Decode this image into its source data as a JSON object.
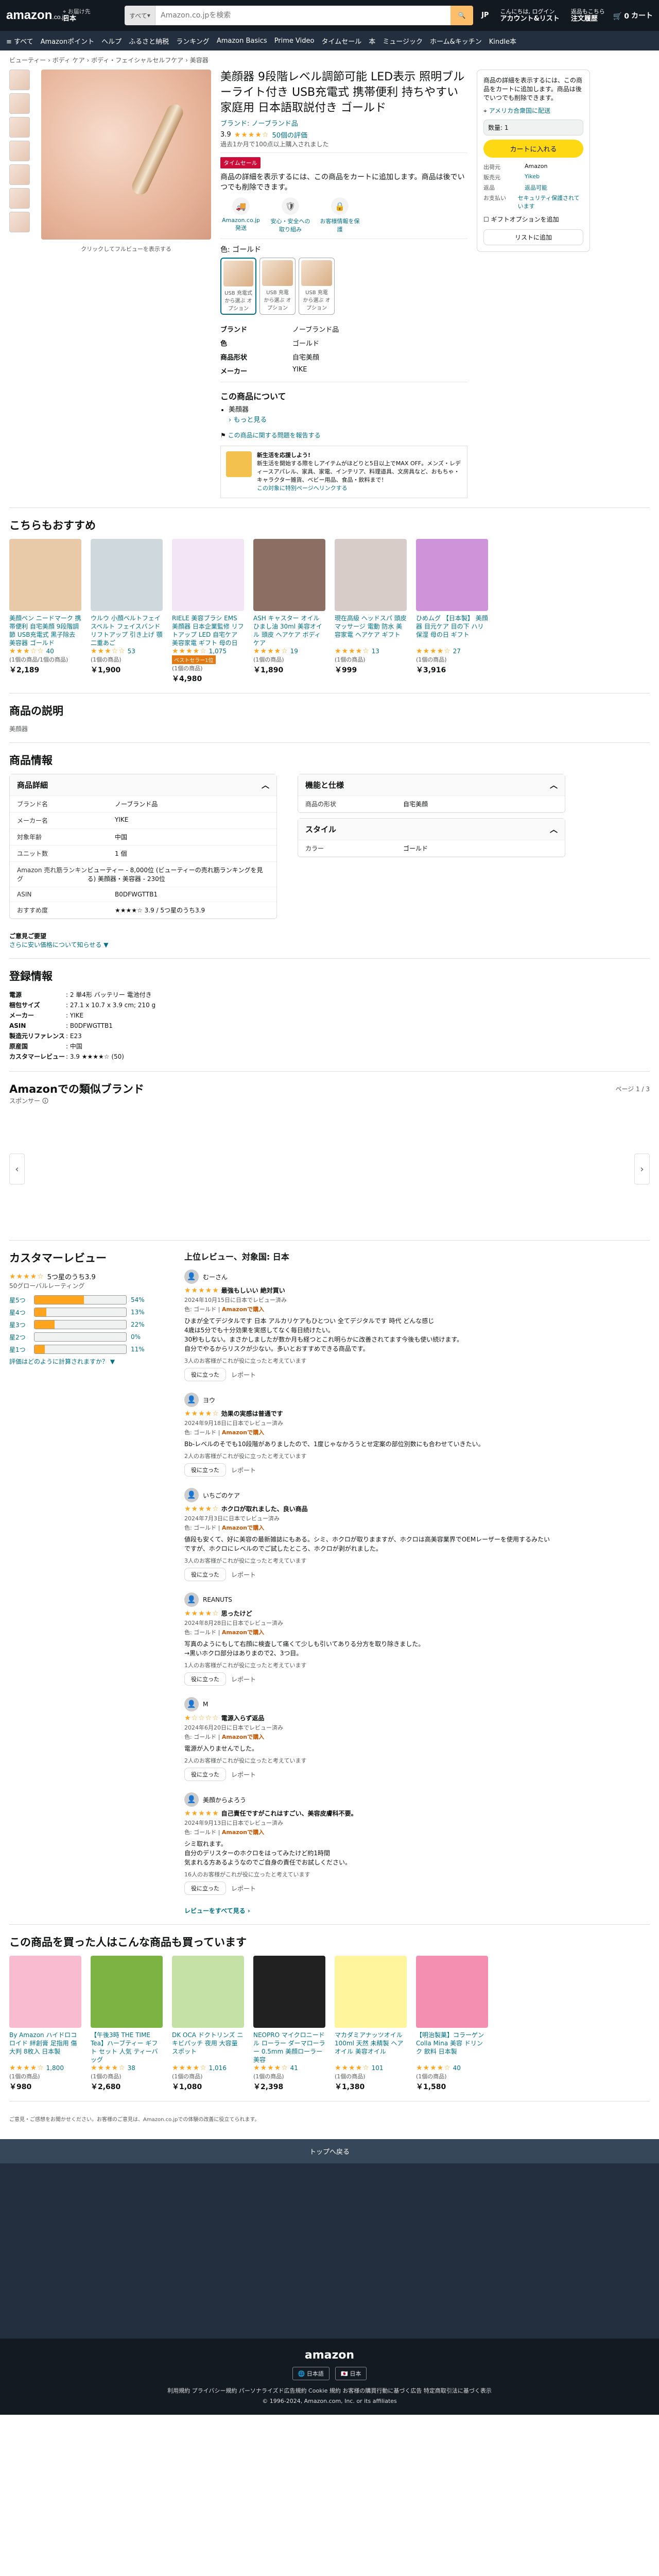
{
  "header": {
    "logo": "amazon",
    "logo_suffix": ".co.jp",
    "deliver_line1": "お届け先",
    "deliver_line2": "日本",
    "search_category": "すべて",
    "search_placeholder": "Amazon.co.jpを検索",
    "lang": "JP",
    "account_line1": "こんにちは, ログイン",
    "account_line2": "アカウント&リスト",
    "orders_line1": "返品もこちら",
    "orders_line2": "注文履歴",
    "cart_label": "カート",
    "cart_count": "0"
  },
  "nav": {
    "menu": "≡ すべて",
    "items": [
      "Amazonポイント",
      "ヘルプ",
      "ふるさと納税",
      "ランキング",
      "Amazon Basics",
      "Prime Video",
      "タイムセール",
      "本",
      "ミュージック",
      "ホーム&キッチン",
      "Kindle本"
    ]
  },
  "breadcrumb": "ビューティー › ボディ ケア › ボディ・フェイシャルセルフケア › 美容器",
  "product": {
    "title": "美顔器 9段階レベル調節可能 LED表示 照明ブルーライト付き USB充電式 携帯便利 持ちやすい 家庭用 日本語取説付き ゴールド",
    "brand": "ブランド: ノーブランド品",
    "rating": "3.9",
    "stars": "★★★★☆",
    "rating_count": "50個の評価",
    "past_month": "過去1か月で100点以上購入されました",
    "badge": "タイムセール",
    "notice": "商品の詳細を表示するには、この商品をカートに追加します。商品は後でいつでも削除できます。",
    "image_note": "クリックしてフルビューを表示する",
    "features": [
      {
        "label": "Amazon.co.jp 発送",
        "icon": "truck-icon"
      },
      {
        "label": "安心・安全への取り組み",
        "icon": "shield-icon"
      },
      {
        "label": "お客様情報を保護",
        "icon": "lock-icon"
      }
    ],
    "color_label": "色: ゴールド",
    "swatches": [
      {
        "name": "USB 充電式",
        "sub": "から選ぶ オプション"
      },
      {
        "name": "USB 充電",
        "sub": "から選ぶ オプション"
      },
      {
        "name": "USB 充電",
        "sub": "から選ぶ オプション"
      }
    ],
    "specs": [
      {
        "k": "ブランド",
        "v": "ノーブランド品"
      },
      {
        "k": "色",
        "v": "ゴールド"
      },
      {
        "k": "商品形状",
        "v": "自宅美顔"
      },
      {
        "k": "メーカー",
        "v": "YIKE"
      }
    ],
    "about_title": "この商品について",
    "about_items": [
      "美顔器",
      "› もっと見る"
    ],
    "report": "この商品に関する問題を報告する",
    "promo_title": "新生活を応援しよう!",
    "promo_text": "新生活を開始する際をしアイテムがほどりと5日以上でMAX OFF。メンズ・レディースアパレル、家具、家電、インテリア、料理道具、文房具など、おもちゃ・キャラクター雑貨、ベビー用品、食品・飲料まで！",
    "promo_link": "この対象に特別ページへリンクする"
  },
  "buybox": {
    "text": "商品の詳細を表示するには、この商品をカートに追加します。商品は後でいつでも削除できます。",
    "delivery": "アメリカ合衆国に配送",
    "qty": "数量: 1",
    "cart_btn": "カートに入れる",
    "rows": [
      {
        "k": "出荷元",
        "v": "Amazon"
      },
      {
        "k": "販売元",
        "v": "Yikeb"
      },
      {
        "k": "返品",
        "v": "返品可能"
      },
      {
        "k": "お支払い",
        "v": "セキュリティ保護されています"
      }
    ],
    "gift": "ギフトオプションを追加",
    "list_btn": "リストに追加"
  },
  "recommend": {
    "title": "こちらもおすすめ",
    "cards": [
      {
        "title": "美顔ペン ニードマーク 携帯便利 自宅美顔 9段階調節 USB充電式 黒子除去 美容器 ゴールド",
        "stars": "★★★☆☆",
        "count": "40",
        "price": "￥2,189",
        "meta": "(1個の商品/1個の商品)",
        "color": "#e8c9a8"
      },
      {
        "title": "ウルウ 小顔ベルトフェイスベルト フェイスバンド リフトアップ 引き上げ 顎 二重あご",
        "stars": "★★★☆☆",
        "count": "53",
        "price": "￥1,900",
        "meta": "(1個の商品)",
        "color": "#cfd8dc"
      },
      {
        "title": "RIELE 美容ブラシ EMS 美顔器 日本企業監修 リフトアップ LED 自宅ケア 美容家電 ギフト 母の日 プレゼント",
        "stars": "★★★★☆",
        "count": "1,075",
        "price": "￥4,980",
        "meta": "(1個の商品)",
        "color": "#f3e5f5",
        "bestseller": "ベストセラー1位"
      },
      {
        "title": "ASH キャスター オイル ひまし油 30ml 美容オイル 頭皮 ヘアケア ボディ ケア",
        "stars": "★★★★☆",
        "count": "19",
        "price": "￥1,890",
        "meta": "(1個の商品)",
        "color": "#8d6e63"
      },
      {
        "title": "現在高級 ヘッドスパ 頭皮マッサージ 電動 防水 美容家電 ヘアケア ギフト",
        "stars": "★★★★☆",
        "count": "13",
        "price": "￥999",
        "meta": "(1個の商品)",
        "color": "#d7ccc8"
      },
      {
        "title": "ひめムグ 【日本製】 美顔器 目元ケア 目の下 ハリ 保湿 母の日 ギフト",
        "stars": "★★★★☆",
        "count": "27",
        "price": "￥3,916",
        "meta": "(1個の商品)",
        "color": "#ce93d8"
      }
    ]
  },
  "desc": {
    "title": "商品の説明",
    "body": "美顔器"
  },
  "info": {
    "title": "商品情報",
    "detail_title": "商品詳細",
    "detail_rows": [
      {
        "k": "ブランド名",
        "v": "ノーブランド品"
      },
      {
        "k": "メーカー名",
        "v": "YIKE"
      },
      {
        "k": "対象年齢",
        "v": "中国"
      },
      {
        "k": "ユニット数",
        "v": "1 個"
      },
      {
        "k": "Amazon 売れ筋ランキング",
        "v": "ビューティー - 8,000位 (ビューティーの売れ筋ランキングを見る) 美顔器・美容器 - 230位"
      },
      {
        "k": "ASIN",
        "v": "B0DFWGTTB1"
      },
      {
        "k": "おすすめ度",
        "v": "★★★★☆ 3.9 / 5つ星のうち3.9"
      }
    ],
    "func_title": "機能と仕様",
    "func_rows": [
      {
        "k": "商品の形状",
        "v": "自宅美顔"
      }
    ],
    "style_title": "スタイル",
    "style_rows": [
      {
        "k": "カラー",
        "v": "ゴールド"
      }
    ],
    "feedback": "ご意見ご要望",
    "feedback_link": "さらに安い価格について知らせる ▼"
  },
  "reg": {
    "title": "登録情報",
    "rows": [
      {
        "k": "電源",
        "v": ": 2 単4形 バッテリー 電池付き"
      },
      {
        "k": "梱包サイズ",
        "v": ": 27.1 x 10.7 x 3.9 cm; 210 g"
      },
      {
        "k": "メーカー",
        "v": ": YIKE"
      },
      {
        "k": "ASIN",
        "v": ": B0DFWGTTB1"
      },
      {
        "k": "製造元リファレンス",
        "v": ": E23"
      },
      {
        "k": "原産国",
        "v": ": 中国"
      },
      {
        "k": "カスタマーレビュー",
        "v": ": 3.9 ★★★★☆ (50)"
      }
    ]
  },
  "brands": {
    "title": "Amazonでの類似ブランド",
    "subtitle": "スポンサー 🛈",
    "page": "ページ 1 / 3"
  },
  "reviews": {
    "title": "カスタマーレビュー",
    "stars": "★★★★☆",
    "avg": "5つ星のうち3.9",
    "total": "50グローバルレーティング",
    "hist": [
      {
        "label": "星5つ",
        "pct": 54
      },
      {
        "label": "星4つ",
        "pct": 13
      },
      {
        "label": "星3つ",
        "pct": 22
      },
      {
        "label": "星2つ",
        "pct": 0
      },
      {
        "label": "星1つ",
        "pct": 11
      }
    ],
    "how": "評価はどのように計算されますか？ ▼",
    "top_title": "上位レビュー、対象国: 日本",
    "items": [
      {
        "user": "むーさん",
        "stars": "★★★★★",
        "title": "最強もしいい 絶対買い",
        "date": "2024年10月15日に日本でレビュー済み",
        "variant": "色: ゴールド",
        "vp": "Amazonで購入",
        "body": "ひまが全てデジタルです 日本 アルカリケアもひとつい 全てデジタルです 時代 どんな感じ\n4歳は5分でも十分効果を実感してなく毎日続けたい。\n30秒もしない。まさかしましたが数か月も経つとこれ明らかに改善されてます今後も使い続けます。\n自分でやるからリスクが少ない。多いとおすすめできる商品です。",
        "helpful": "3人のお客様がこれが役に立ったと考えています"
      },
      {
        "user": "ヨウ",
        "stars": "★★★★☆",
        "title": "効果の実感は普通です",
        "date": "2024年9月18日に日本でレビュー済み",
        "variant": "色: ゴールド",
        "vp": "Amazonで購入",
        "body": "Bb-レベルのそでも10段階がありましたので、1度じゃなかろうとせ定案の部位別数にも合わせていきたい。",
        "helpful": "2人のお客様がこれが役に立ったと考えています"
      },
      {
        "user": "いちごのケア",
        "stars": "★★★★☆",
        "title": "ホクロが取れました、良い商品",
        "date": "2024年7月3日に日本でレビュー済み",
        "variant": "色: ゴールド",
        "vp": "Amazonで購入",
        "body": "値段も安くて、好に美容の最新雑誌にもある。シミ、ホクロが取りまますが、ホクロは高美容業界でOEMレーザーを使用するみたいですが、ホクロにレベルのでご試したところ、ホクロが剥がれました。",
        "helpful": "3人のお客様がこれが役に立ったと考えています"
      },
      {
        "user": "REANUTS",
        "stars": "★★★★☆",
        "title": "思ったけど",
        "date": "2024年8月28日に日本でレビュー済み",
        "variant": "色: ゴールド",
        "vp": "Amazonで購入",
        "body": "写真のようにもして右顔に検査して痛くて少しも引いてありる分方を取り除きました。\n→黒いホクロ部分はありまので2、3つ目。",
        "helpful": "1人のお客様がこれが役に立ったと考えています"
      },
      {
        "user": "M",
        "stars": "★☆☆☆☆",
        "title": "電源入らず返品",
        "date": "2024年6月20日に日本でレビュー済み",
        "variant": "色: ゴールド",
        "vp": "Amazonで購入",
        "body": "電源が入りませんでした。",
        "helpful": "2人のお客様がこれが役に立ったと考えています"
      },
      {
        "user": "美顔からよろう",
        "stars": "★★★★★",
        "title": "自己責任ですがこれはすごい、美容皮膚科不要。",
        "date": "2024年9月13日に日本でレビュー済み",
        "variant": "色: ゴールド",
        "vp": "Amazonで購入",
        "body": "シミ取れます。\n自分のデリスターのホクロをはってみたけど約1時間\n気まれる方あるようなのでご自身の責任でお試しください。",
        "helpful": "16人のお客様がこれが役に立ったと考えています"
      }
    ],
    "help_btn": "役に立った",
    "report": "レポート",
    "more": "レビューをすべて見る ›"
  },
  "also": {
    "title": "この商品を買った人はこんな商品も買っています",
    "cards": [
      {
        "title": "By Amazon ハイドロコロイド 絆創膏 足指用 傷 大判 8枚入 日本製",
        "stars": "★★★★☆",
        "count": "1,800",
        "price": "￥980",
        "meta": "(1個の商品)",
        "color": "#f8bbd0"
      },
      {
        "title": "【午後3時 THE TIME Tea】ハーブティー ギフト セット 人気 ティーバッグ",
        "stars": "★★★★☆",
        "count": "38",
        "price": "￥2,680",
        "meta": "(1個の商品)",
        "color": "#7cb342"
      },
      {
        "title": "DK OCA ドクトリンズ ニキビパッチ 夜用 大容量 スポット",
        "stars": "★★★★☆",
        "count": "1,016",
        "price": "￥1,080",
        "meta": "(1個の商品)",
        "color": "#c5e1a5"
      },
      {
        "title": "NEOPRO マイクロニードル ローラー ダーマローラー 0.5mm 美顔ローラー 美容",
        "stars": "★★★★☆",
        "count": "41",
        "price": "￥2,398",
        "meta": "(1個の商品)",
        "color": "#212121"
      },
      {
        "title": "マカダミアナッツオイル 100ml 天然 未精製 ヘアオイル 美容オイル",
        "stars": "★★★★☆",
        "count": "101",
        "price": "￥1,380",
        "meta": "(1個の商品)",
        "color": "#fff59d"
      },
      {
        "title": "【明治製菓】コラーゲン Colla Mina 美容 ドリンク 飲料 日本製",
        "stars": "★★★★☆",
        "count": "40",
        "price": "￥1,580",
        "meta": "(1個の商品)",
        "color": "#f48fb1"
      }
    ]
  },
  "footer": {
    "note": "ご意見・ご感想をお聞かせください。お客様のご意見は、Amazon.co.jpでの体験の改善に役立てられます。",
    "backtop": "トップへ戻る",
    "logo": "amazon",
    "lang": "🌐 日本語",
    "country": "🇯🇵 日本",
    "links": "利用規約   プライバシー規約   パーソナライズド広告規約   Cookie 規約   お客様の購買行動に基づく広告   特定商取引法に基づく表示",
    "copyright": "© 1996-2024, Amazon.com, Inc. or its affiliates"
  }
}
